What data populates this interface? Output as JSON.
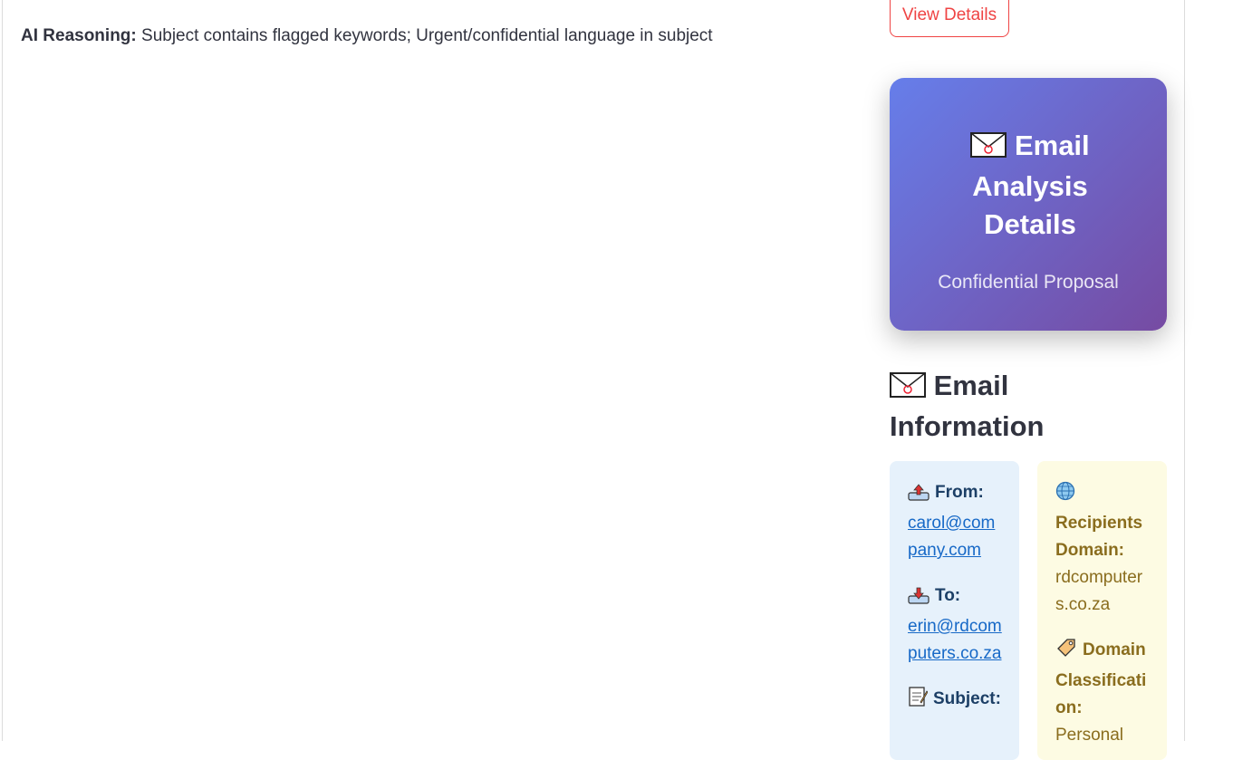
{
  "reasoning": {
    "label": "AI Reasoning:",
    "text": "Subject contains flagged keywords; Urgent/confidential language in subject"
  },
  "view_details_label": "View Details",
  "hero": {
    "title": "Email Analysis Details",
    "subtitle": "Confidential Proposal"
  },
  "section": {
    "title": "Email Information"
  },
  "sender_card": {
    "from_label": "From:",
    "from_value": "carol@company.com",
    "to_label": "To:",
    "to_value": "erin@rdcomputers.co.za",
    "subject_label": "Subject:"
  },
  "domain_card": {
    "recipients_domain_label": "Recipients Domain:",
    "recipients_domain_value": "rdcomputers.co.za",
    "classification_label": "Domain Classification:",
    "classification_value": "Personal"
  },
  "colors": {
    "accent_red": "#ef4444",
    "gradient_start": "#667eea",
    "gradient_end": "#764ba2",
    "link_blue": "#1769c7"
  },
  "icons": [
    "envelope-icon",
    "outbox-icon",
    "inbox-icon",
    "memo-icon",
    "globe-icon",
    "tag-icon"
  ]
}
